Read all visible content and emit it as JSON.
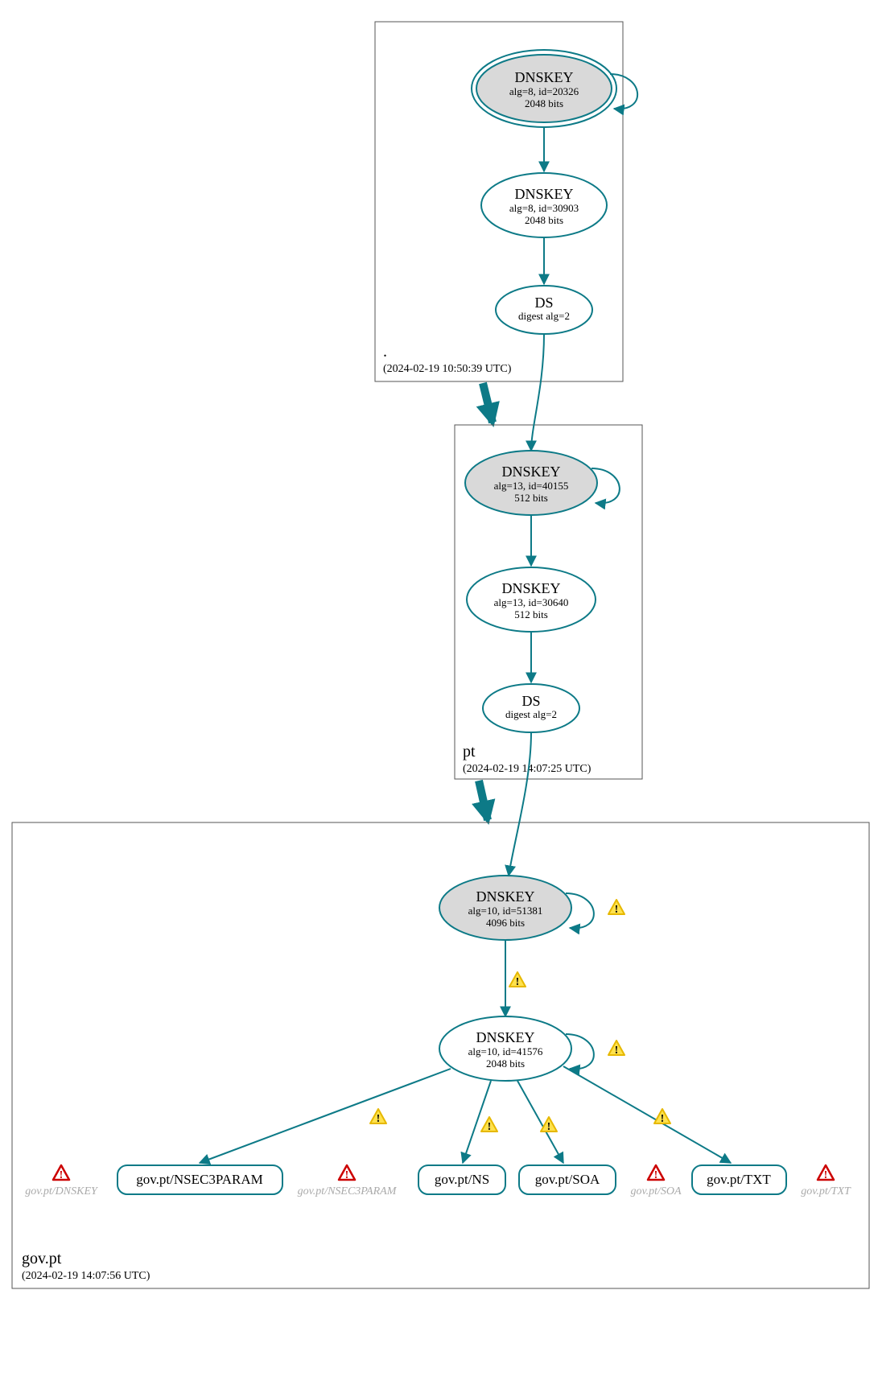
{
  "zones": {
    "root": {
      "name": ".",
      "timestamp": "(2024-02-19 10:50:39 UTC)"
    },
    "pt": {
      "name": "pt",
      "timestamp": "(2024-02-19 14:07:25 UTC)"
    },
    "gov": {
      "name": "gov.pt",
      "timestamp": "(2024-02-19 14:07:56 UTC)"
    }
  },
  "nodes": {
    "root_ksk": {
      "title": "DNSKEY",
      "line2": "alg=8, id=20326",
      "line3": "2048 bits"
    },
    "root_zsk": {
      "title": "DNSKEY",
      "line2": "alg=8, id=30903",
      "line3": "2048 bits"
    },
    "root_ds": {
      "title": "DS",
      "line2": "digest alg=2"
    },
    "pt_ksk": {
      "title": "DNSKEY",
      "line2": "alg=13, id=40155",
      "line3": "512 bits"
    },
    "pt_zsk": {
      "title": "DNSKEY",
      "line2": "alg=13, id=30640",
      "line3": "512 bits"
    },
    "pt_ds": {
      "title": "DS",
      "line2": "digest alg=2"
    },
    "gov_ksk": {
      "title": "DNSKEY",
      "line2": "alg=10, id=51381",
      "line3": "4096 bits"
    },
    "gov_zsk": {
      "title": "DNSKEY",
      "line2": "alg=10, id=41576",
      "line3": "2048 bits"
    }
  },
  "rr": {
    "nsec3param": "gov.pt/NSEC3PARAM",
    "ns": "gov.pt/NS",
    "soa": "gov.pt/SOA",
    "txt": "gov.pt/TXT"
  },
  "ghosts": {
    "dnskey": "gov.pt/DNSKEY",
    "nsec3param": "gov.pt/NSEC3PARAM",
    "soa": "gov.pt/SOA",
    "txt": "gov.pt/TXT"
  }
}
